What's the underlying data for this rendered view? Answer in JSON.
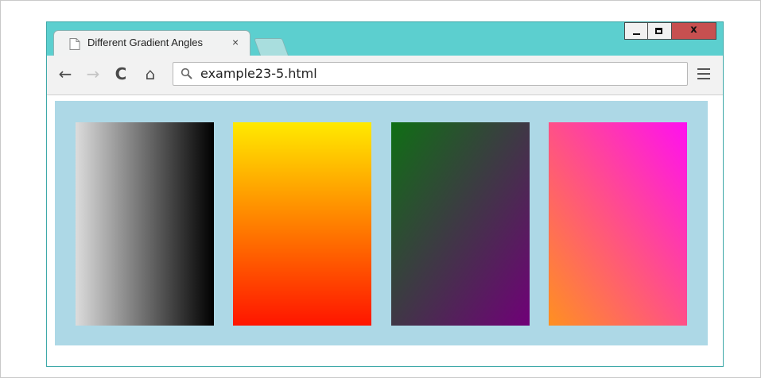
{
  "browser": {
    "tab_title": "Different Gradient Angles",
    "tab_close": "×",
    "url": "example23-5.html",
    "icons": {
      "page": "page-icon",
      "back": "back-arrow-icon",
      "forward": "forward-arrow-icon",
      "reload": "reload-icon",
      "home": "home-icon",
      "search": "search-icon",
      "menu": "menu-icon"
    },
    "glyphs": {
      "back": "←",
      "forward": "→",
      "reload": "C",
      "home": "⌂",
      "close": "x"
    },
    "colors": {
      "frame": "#5ccfcf",
      "close_button": "#c75050"
    }
  },
  "page": {
    "background": "#add8e6",
    "gradients": [
      {
        "angle": "to right",
        "colors": [
          "#dcdcdc",
          "#000000"
        ]
      },
      {
        "angle": "to bottom",
        "colors": [
          "#ffea00",
          "#ff1500"
        ]
      },
      {
        "angle": "to bottom right",
        "colors": [
          "#0f6f14",
          "#700078"
        ]
      },
      {
        "angle": "to top right",
        "colors": [
          "#ff9020",
          "#ff10f0"
        ]
      }
    ]
  }
}
